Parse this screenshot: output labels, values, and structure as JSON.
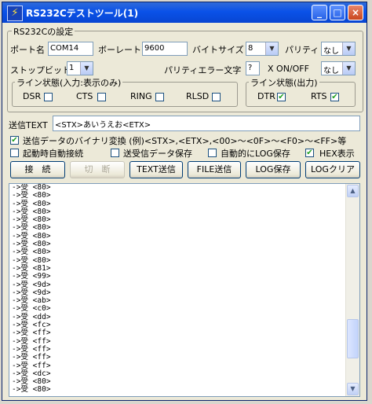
{
  "window": {
    "title": "RS232Cテストツール(1)",
    "minimize": "_",
    "maximize": "□",
    "close": "×",
    "app_icon": "lightning-icon"
  },
  "settings": {
    "group_label": "RS232Cの設定",
    "port_label": "ポート名",
    "port_value": "COM14",
    "baud_label": "ボーレート",
    "baud_value": "9600",
    "bytesize_label": "バイトサイズ",
    "bytesize_value": "8",
    "parity_label": "パリティ",
    "parity_value": "なし",
    "stopbit_label": "ストップビット",
    "stopbit_value": "1",
    "parity_err_label": "パリティエラー文字",
    "parity_err_value": "?",
    "xonoff_label": "X ON/OFF",
    "xonoff_value": "なし"
  },
  "line_in": {
    "group_label": "ライン状態(入力:表示のみ)",
    "dsr": "DSR",
    "cts": "CTS",
    "ring": "RING",
    "rlsd": "RLSD"
  },
  "line_out": {
    "group_label": "ライン状態(出力)",
    "dtr": "DTR",
    "rts": "RTS",
    "dtr_checked": true,
    "rts_checked": true
  },
  "send": {
    "label": "送信TEXT",
    "value": "<STX>あいうえお<ETX>"
  },
  "options": {
    "binary_convert": "送信データのバイナリ変換 (例)<STX>,<ETX>,<00>～<0F>～<F0>～<FF>等",
    "auto_connect": "起動時自動接続",
    "save_data": "送受信データ保存",
    "auto_log": "自動的にLOG保存",
    "hex_display": "HEX表示",
    "binary_checked": true,
    "hex_checked": true
  },
  "buttons": {
    "connect": "接　続",
    "disconnect": "切　断",
    "text_send": "TEXT送信",
    "file_send": "FILE送信",
    "log_save": "LOG保存",
    "log_clear": "LOGクリア"
  },
  "log": {
    "lines": [
      "->受 <80>",
      "->受 <80>",
      "->受 <80>",
      "->受 <80>",
      "->受 <80>",
      "->受 <80>",
      "->受 <80>",
      "->受 <80>",
      "->受 <80>",
      "->受 <80>",
      "->受 <81>",
      "->受 <99>",
      "->受 <9d>",
      "->受 <9d>",
      "->受 <ab>",
      "->受 <c0>",
      "->受 <dd>",
      "->受 <fc>",
      "->受 <ff>",
      "->受 <ff>",
      "->受 <ff>",
      "->受 <ff>",
      "->受 <ff>",
      "->受 <dc>",
      "->受 <80>",
      "->受 <80>"
    ]
  }
}
